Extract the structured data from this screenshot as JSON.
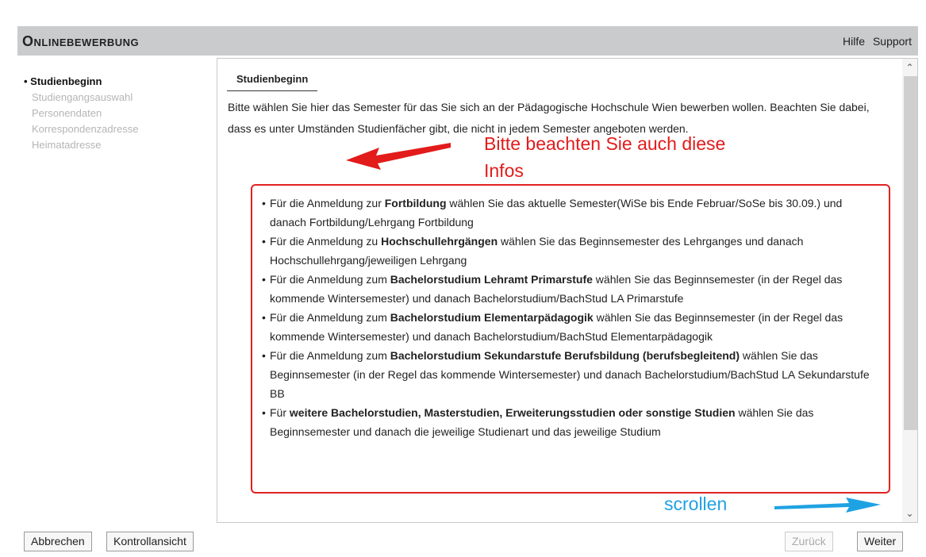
{
  "header": {
    "title": "Onlinebewerbung",
    "help_label": "Hilfe",
    "support_label": "Support"
  },
  "sidebar": {
    "items": [
      {
        "label": "Studienbeginn",
        "active": true
      },
      {
        "label": "Studiengangsauswahl",
        "active": false
      },
      {
        "label": "Personendaten",
        "active": false
      },
      {
        "label": "Korrespondenzadresse",
        "active": false
      },
      {
        "label": "Heimatadresse",
        "active": false
      }
    ]
  },
  "main": {
    "tab_label": "Studienbeginn",
    "intro": "Bitte wählen Sie hier das Semester für das Sie sich an der Pädagogische Hochschule Wien bewerben wollen. Beachten Sie dabei, dass es unter Umständen Studienfächer gibt, die nicht in jedem Semester angeboten werden.",
    "annotation_notice": "Bitte beachten Sie auch diese Infos",
    "annotation_scroll": "scrollen",
    "info_items": [
      {
        "pre": "Für die Anmeldung zur ",
        "bold": "Fortbildung",
        "post": " wählen Sie das aktuelle Semester(WiSe bis Ende Februar/SoSe bis 30.09.) und danach Fortbildung/Lehrgang Fortbildung"
      },
      {
        "pre": "Für die Anmeldung zu ",
        "bold": "Hochschullehrgängen",
        "post": " wählen Sie das Beginnsemester des Lehrganges und danach Hochschullehrgang/jeweiligen Lehrgang"
      },
      {
        "pre": "Für die Anmeldung zum ",
        "bold": "Bachelorstudium Lehramt Primarstufe",
        "post": " wählen Sie das Beginnsemester (in der Regel das kommende Wintersemester) und danach Bachelorstudium/BachStud LA Primarstufe"
      },
      {
        "pre": "Für die Anmeldung zum ",
        "bold": "Bachelorstudium Elementarpädagogik",
        "post": " wählen Sie das Beginnsemester (in der Regel das kommende Wintersemester) und danach Bachelorstudium/BachStud Elementarpädagogik"
      },
      {
        "pre": "Für die Anmeldung zum ",
        "bold": "Bachelorstudium Sekundarstufe Berufsbildung (berufsbegleitend)",
        "post": " wählen Sie das Beginnsemester (in der Regel das kommende Wintersemester) und danach Bachelorstudium/BachStud LA Sekundarstufe BB"
      },
      {
        "pre": "Für ",
        "bold": "weitere Bachelorstudien, Masterstudien, Erweiterungsstudien oder sonstige Studien",
        "post": " wählen Sie das Beginnsemester und danach die jeweilige Studienart und das jeweilige Studium"
      }
    ]
  },
  "footer": {
    "cancel_label": "Abbrechen",
    "review_label": "Kontrollansicht",
    "back_label": "Zurück",
    "next_label": "Weiter"
  },
  "colors": {
    "header_bg": "#c9cbcd",
    "annotation_red": "#e21b1b",
    "annotation_blue": "#1fa2e3"
  },
  "icons": {
    "scroll_up": "chevron-up-icon",
    "scroll_down": "chevron-down-icon"
  }
}
